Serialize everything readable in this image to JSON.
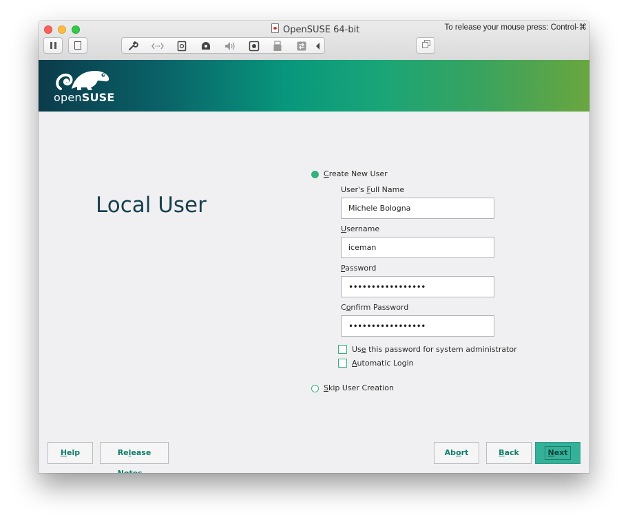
{
  "window": {
    "title": "OpenSUSE 64-bit",
    "release_hint": "To release your mouse press: Control-⌘"
  },
  "toolbar": {
    "icons": [
      "pause-icon",
      "snapshot-icon",
      "settings-wrench-icon",
      "network-icon",
      "disk-icon",
      "optical-drive-icon",
      "sound-icon",
      "camera-icon",
      "usb-icon",
      "share-icon",
      "collapse-arrow-icon",
      "fullscreen-icon"
    ]
  },
  "banner": {
    "logo_word_light": "open",
    "logo_word_bold": "SUSE"
  },
  "page": {
    "title": "Local User"
  },
  "form": {
    "create_option": {
      "prefix": "",
      "mnemonic": "C",
      "rest": "reate New User",
      "selected": true
    },
    "full_name": {
      "label_pre": "User's ",
      "label_mn": "F",
      "label_post": "ull Name",
      "value": "Michele Bologna"
    },
    "username": {
      "label_pre": "",
      "label_mn": "U",
      "label_post": "sername",
      "value": "iceman"
    },
    "password": {
      "label_pre": "",
      "label_mn": "P",
      "label_post": "assword",
      "value": "•••••••••••••••••"
    },
    "confirm_password": {
      "label_pre": "C",
      "label_mn": "o",
      "label_post": "nfirm Password",
      "value": "•••••••••••••••••"
    },
    "admin_checkbox": {
      "pre": "Us",
      "mn": "e",
      "post": " this password for system administrator",
      "checked": false
    },
    "autologin_checkbox": {
      "pre": "",
      "mn": "A",
      "post": "utomatic Login",
      "checked": false
    },
    "skip_option": {
      "prefix": "",
      "mnemonic": "S",
      "rest": "kip User Creation",
      "selected": false
    }
  },
  "buttons": {
    "help": {
      "pre": "",
      "mn": "H",
      "post": "elp"
    },
    "release_notes": {
      "pre": "Re",
      "mn": "l",
      "post": "ease Notes..."
    },
    "abort": {
      "pre": "Ab",
      "mn": "o",
      "post": "rt"
    },
    "back": {
      "pre": "",
      "mn": "B",
      "post": "ack"
    },
    "next": {
      "pre": "",
      "mn": "N",
      "post": "ext"
    }
  },
  "colors": {
    "accent": "#35b17e",
    "next_button": "#35b19a",
    "title_text": "#173f4f",
    "button_text": "#0e7d6a"
  }
}
